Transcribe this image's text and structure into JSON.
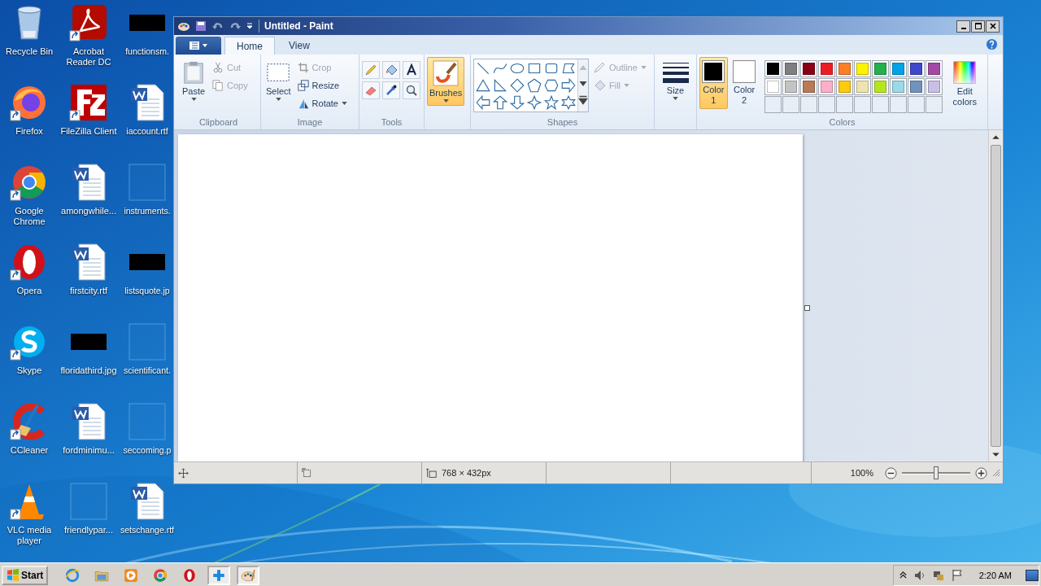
{
  "desktop_icons": [
    {
      "label": "Recycle Bin",
      "kind": "recycle",
      "shortcut": false
    },
    {
      "label": "Firefox",
      "kind": "firefox",
      "shortcut": true
    },
    {
      "label": "Google Chrome",
      "kind": "chrome",
      "shortcut": true
    },
    {
      "label": "Opera",
      "kind": "opera",
      "shortcut": true
    },
    {
      "label": "Skype",
      "kind": "skype",
      "shortcut": true
    },
    {
      "label": "CCleaner",
      "kind": "ccleaner",
      "shortcut": true
    },
    {
      "label": "VLC media player",
      "kind": "vlc",
      "shortcut": true
    },
    {
      "label": "Acrobat Reader DC",
      "kind": "pdf",
      "shortcut": true
    },
    {
      "label": "FileZilla Client",
      "kind": "filezilla",
      "shortcut": true
    },
    {
      "label": "amongwhile...",
      "kind": "document",
      "shortcut": false
    },
    {
      "label": "firstcity.rtf",
      "kind": "document",
      "shortcut": false
    },
    {
      "label": "floridathird.jpg",
      "kind": "thumbnail",
      "shortcut": false
    },
    {
      "label": "fordminimu...",
      "kind": "document",
      "shortcut": false
    },
    {
      "label": "friendlypar...",
      "kind": "blank",
      "shortcut": false
    },
    {
      "label": "functionsm.",
      "kind": "thumbnail",
      "shortcut": false
    },
    {
      "label": "iaccount.rtf",
      "kind": "document",
      "shortcut": false
    },
    {
      "label": "instruments.",
      "kind": "blank",
      "shortcut": false
    },
    {
      "label": "listsquote.jp",
      "kind": "thumbnail",
      "shortcut": false
    },
    {
      "label": "scientificant.",
      "kind": "blank",
      "shortcut": false
    },
    {
      "label": "seccoming.p",
      "kind": "blank",
      "shortcut": false
    },
    {
      "label": "setschange.rtf",
      "kind": "document",
      "shortcut": false
    }
  ],
  "paint_window": {
    "title": "Untitled - Paint",
    "tabs": [
      {
        "label": "Home",
        "selected": true
      },
      {
        "label": "View",
        "selected": false
      }
    ],
    "clipboard": {
      "label": "Clipboard",
      "paste": "Paste",
      "items": [
        {
          "label": "Cut",
          "kind": "cut",
          "disabled": true
        },
        {
          "label": "Copy",
          "kind": "copy",
          "disabled": true
        }
      ]
    },
    "image": {
      "label": "Image",
      "select": "Select",
      "items": [
        {
          "label": "Crop",
          "kind": "crop",
          "disabled": true
        },
        {
          "label": "Resize",
          "kind": "resize",
          "disabled": false
        },
        {
          "label": "Rotate",
          "kind": "rotate",
          "disabled": false
        }
      ]
    },
    "tools": {
      "label": "Tools"
    },
    "brushes": {
      "label": "Brushes",
      "selected": true
    },
    "shapes": {
      "label": "Shapes",
      "outline": {
        "label": "Outline",
        "disabled": true
      },
      "fill": {
        "label": "Fill",
        "disabled": true
      }
    },
    "size": {
      "label": "Size"
    },
    "colors": {
      "label": "Colors",
      "slots": [
        {
          "label": "Color",
          "number": "1",
          "selected": true,
          "color": "#000000"
        },
        {
          "label": "Color",
          "number": "2",
          "selected": false,
          "color": "#ffffff"
        }
      ],
      "palette": [
        {
          "color": "#000000"
        },
        {
          "color": "#7f7f7f"
        },
        {
          "color": "#880015"
        },
        {
          "color": "#ed1c24"
        },
        {
          "color": "#ff7f27"
        },
        {
          "color": "#fff200"
        },
        {
          "color": "#22b14c"
        },
        {
          "color": "#00a2e8"
        },
        {
          "color": "#3f48cc"
        },
        {
          "color": "#a349a4"
        },
        {
          "color": "#ffffff"
        },
        {
          "color": "#c3c3c3"
        },
        {
          "color": "#b97a57"
        },
        {
          "color": "#ffaec9"
        },
        {
          "color": "#ffc90e"
        },
        {
          "color": "#efe4b0"
        },
        {
          "color": "#b5e61d"
        },
        {
          "color": "#99d9ea"
        },
        {
          "color": "#7092be"
        },
        {
          "color": "#c8bfe7"
        }
      ],
      "edit": "Edit colors"
    },
    "status_bar": {
      "image_size": "768 × 432px",
      "zoom": "100%",
      "zoom_level": {
        "level": 0.5
      }
    }
  },
  "taskbar": {
    "start": "Start",
    "buttons": [
      {
        "kind": "ie",
        "active": false
      },
      {
        "kind": "folder",
        "active": false
      },
      {
        "kind": "media",
        "active": false
      },
      {
        "kind": "chrome",
        "active": false
      },
      {
        "kind": "opera",
        "active": false
      },
      {
        "kind": "plus",
        "active": true
      },
      {
        "kind": "paint",
        "active": true
      }
    ],
    "clock": "2:20 AM"
  }
}
